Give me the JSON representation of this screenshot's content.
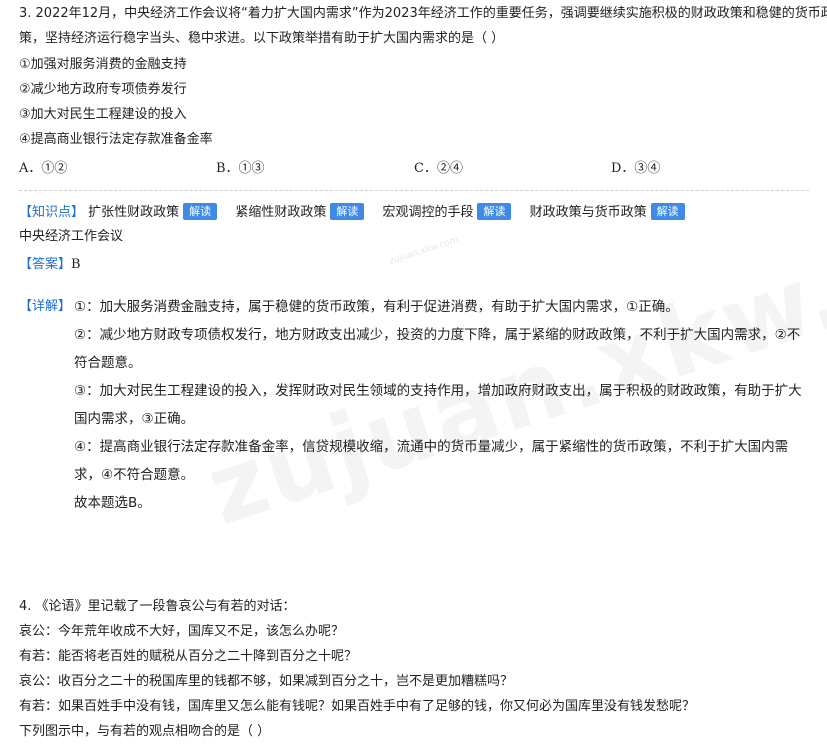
{
  "q3": {
    "stem_line1": "3. 2022年12月，中央经济工作会议将“着力扩大国内需求”作为2023年经济工作的重要任务，强调要继续实施积极的财政政策和稳健的货币政",
    "stem_line2": "策，坚持经济运行稳字当头、稳中求进。以下政策举措有助于扩大国内需求的是（     ）",
    "items": [
      "①加强对服务消费的金融支持",
      "②减少地方政府专项债券发行",
      "③加大对民生工程建设的投入",
      "④提高商业银行法定存款准备金率"
    ],
    "options": [
      "A．①②",
      "B．①③",
      "C．②④",
      "D．③④"
    ],
    "knowledge_label": "【知识点】",
    "knowledge_points": [
      "扩张性财政政策",
      "紧缩性财政政策",
      "宏观调控的手段",
      "财政政策与货币政策"
    ],
    "explain_button": "解读",
    "extra_point": "中央经济工作会议",
    "answer_label": "【答案】",
    "answer": "B",
    "detail_label": "【详解】",
    "detail": [
      "①：加大服务消费金融支持，属于稳健的货币政策，有利于促进消费，有助于扩大国内需求，①正确。",
      "②：减少地方财政专项债权发行，地方财政支出减少，投资的力度下降，属于紧缩的财政政策，不利于扩大国内需求，②不符合题意。",
      "③：加大对民生工程建设的投入，发挥财政对民生领域的支持作用，增加政府财政支出，属于积极的财政政策，有助于扩大国内需求，③正确。",
      "④：提高商业银行法定存款准备金率，信贷规模收缩，流通中的货币量减少，属于紧缩性的货币政策，不利于扩大国内需求，④不符合题意。",
      "故本题选B。"
    ]
  },
  "q4": {
    "lines": [
      "4. 《论语》里记载了一段鲁哀公与有若的对话：",
      "哀公：今年荒年收成不大好，国库又不足，该怎么办呢？",
      "有若：能否将老百姓的赋税从百分之二十降到百分之十呢？",
      "哀公：收百分之二十的税国库里的钱都不够，如果减到百分之十，岂不是更加糟糕吗？",
      "有若：如果百姓手中没有钱，国库里又怎么能有钱呢？如果百姓手中有了足够的钱，你又何必为国库里没有钱发愁呢？",
      "下列图示中，与有若的观点相吻合的是（     ）"
    ]
  },
  "watermark": "zujuan.xkw.com",
  "watermark_small": "zujuan.xkw.com"
}
